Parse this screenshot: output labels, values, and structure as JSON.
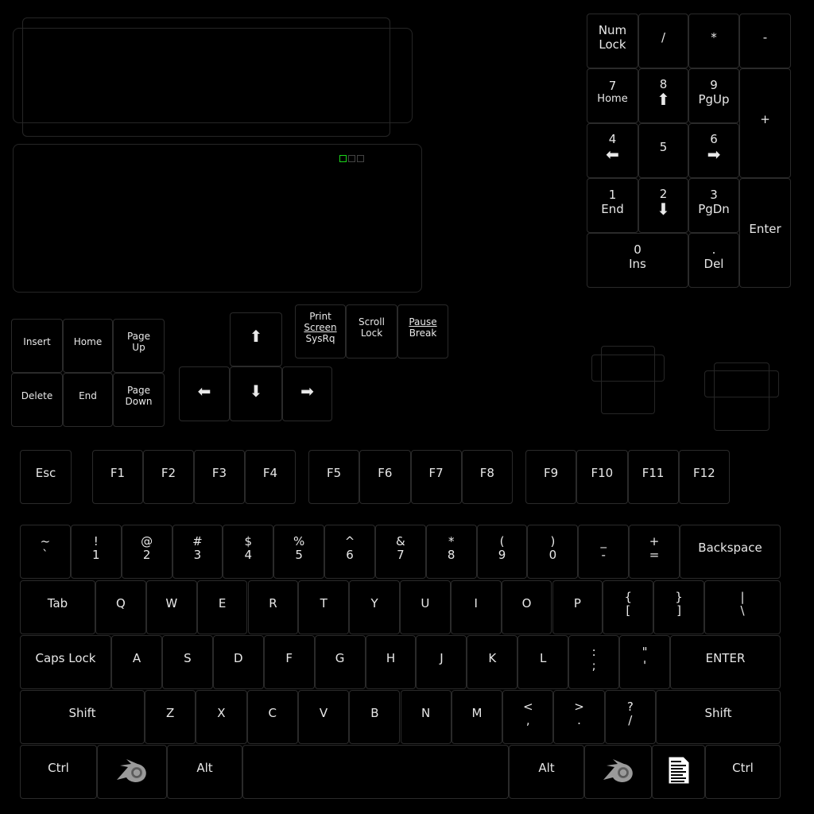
{
  "colors": {
    "background": "#000000",
    "key_border": "#2a2a2a",
    "text": "#e8e8e8",
    "active_mode": "#1bd51b",
    "logo": "#9a9a9a"
  },
  "mode_icons": [
    {
      "name": "mode-1-icon",
      "active": true
    },
    {
      "name": "mode-2-icon",
      "active": false
    },
    {
      "name": "mode-3-icon",
      "active": false
    }
  ],
  "numpad": [
    {
      "label": "Num",
      "sub": "Lock"
    },
    {
      "label": "/"
    },
    {
      "label": "*"
    },
    {
      "label": "-"
    },
    {
      "label": "7",
      "sub": "Home"
    },
    {
      "label": "8",
      "icon": "arrow-up"
    },
    {
      "label": "9",
      "sub": "PgUp"
    },
    {
      "label": "+"
    },
    {
      "label": "4",
      "icon": "arrow-left"
    },
    {
      "label": "5"
    },
    {
      "label": "6",
      "icon": "arrow-right"
    },
    {
      "label": "1",
      "sub": "End"
    },
    {
      "label": "2",
      "icon": "arrow-down"
    },
    {
      "label": "3",
      "sub": "PgDn"
    },
    {
      "label": "Enter"
    },
    {
      "label": "0",
      "sub": "Ins"
    },
    {
      "label": ".",
      "sub": "Del"
    }
  ],
  "navigation": [
    {
      "label": "Insert"
    },
    {
      "label": "Home"
    },
    {
      "label": "Page",
      "sub": "Up"
    },
    {
      "label": "Delete"
    },
    {
      "label": "End"
    },
    {
      "label": "Page",
      "sub": "Down"
    }
  ],
  "arrows": [
    {
      "icon": "arrow-up"
    },
    {
      "icon": "arrow-left"
    },
    {
      "icon": "arrow-down"
    },
    {
      "icon": "arrow-right"
    }
  ],
  "system": [
    {
      "label": "Print",
      "sub": "Screen",
      "sub2": "SysRq"
    },
    {
      "label": "Scroll",
      "sub": "Lock"
    },
    {
      "label": "Pause",
      "sub": "Break"
    }
  ],
  "function_row": [
    {
      "label": "Esc"
    },
    {
      "label": "F1"
    },
    {
      "label": "F2"
    },
    {
      "label": "F3"
    },
    {
      "label": "F4"
    },
    {
      "label": "F5"
    },
    {
      "label": "F6"
    },
    {
      "label": "F7"
    },
    {
      "label": "F8"
    },
    {
      "label": "F9"
    },
    {
      "label": "F10"
    },
    {
      "label": "F11"
    },
    {
      "label": "F12"
    }
  ],
  "number_row": [
    {
      "label": "~",
      "sub": "`"
    },
    {
      "label": "!",
      "sub": "1"
    },
    {
      "label": "@",
      "sub": "2"
    },
    {
      "label": "#",
      "sub": "3"
    },
    {
      "label": "$",
      "sub": "4"
    },
    {
      "label": "%",
      "sub": "5"
    },
    {
      "label": "^",
      "sub": "6"
    },
    {
      "label": "&",
      "sub": "7"
    },
    {
      "label": "*",
      "sub": "8"
    },
    {
      "label": "(",
      "sub": "9"
    },
    {
      "label": ")",
      "sub": "0"
    },
    {
      "label": "_",
      "sub": "-"
    },
    {
      "label": "+",
      "sub": "="
    },
    {
      "label": "Backspace"
    }
  ],
  "tab_row": [
    {
      "label": "Tab"
    },
    {
      "label": "Q"
    },
    {
      "label": "W"
    },
    {
      "label": "E"
    },
    {
      "label": "R"
    },
    {
      "label": "T"
    },
    {
      "label": "Y"
    },
    {
      "label": "U"
    },
    {
      "label": "I"
    },
    {
      "label": "O"
    },
    {
      "label": "P"
    },
    {
      "label": "{",
      "sub": "["
    },
    {
      "label": "}",
      "sub": "]"
    },
    {
      "label": "|",
      "sub": "\\"
    }
  ],
  "caps_row": [
    {
      "label": "Caps Lock"
    },
    {
      "label": "A"
    },
    {
      "label": "S"
    },
    {
      "label": "D"
    },
    {
      "label": "F"
    },
    {
      "label": "G"
    },
    {
      "label": "H"
    },
    {
      "label": "J"
    },
    {
      "label": "K"
    },
    {
      "label": "L"
    },
    {
      "label": ":",
      "sub": ";"
    },
    {
      "label": "\"",
      "sub": "'"
    },
    {
      "label": "ENTER"
    }
  ],
  "shift_row": [
    {
      "label": "Shift"
    },
    {
      "label": "Z"
    },
    {
      "label": "X"
    },
    {
      "label": "C"
    },
    {
      "label": "V"
    },
    {
      "label": "B"
    },
    {
      "label": "N"
    },
    {
      "label": "M"
    },
    {
      "label": "<",
      "sub": ","
    },
    {
      "label": ">",
      "sub": "."
    },
    {
      "label": "?",
      "sub": "/"
    },
    {
      "label": "Shift"
    }
  ],
  "bottom_row": [
    {
      "label": "Ctrl"
    },
    {
      "icon": "blender-logo"
    },
    {
      "label": "Alt"
    },
    {
      "label": ""
    },
    {
      "label": "Alt"
    },
    {
      "icon": "blender-logo"
    },
    {
      "icon": "menu-document"
    },
    {
      "label": "Ctrl"
    }
  ]
}
